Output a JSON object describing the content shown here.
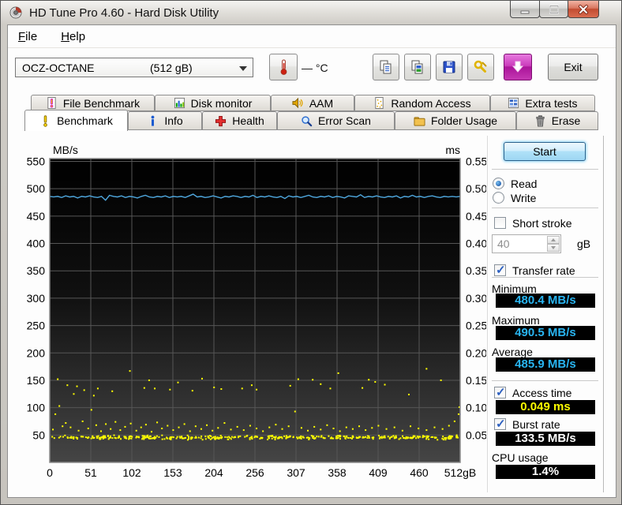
{
  "window": {
    "title": "HD Tune Pro 4.60 - Hard Disk Utility"
  },
  "menu": {
    "file": "File",
    "help": "Help"
  },
  "toolbar": {
    "drive": {
      "name": "OCZ-OCTANE",
      "capacity": "(512 gB)"
    },
    "temperature_display": "— °C",
    "buttons": {
      "copy_text": "copy-text",
      "copy_image": "copy-image",
      "save": "save",
      "options": "options",
      "download": "download",
      "temperature": "temperature"
    },
    "exit_label": "Exit"
  },
  "tabs": {
    "row1": [
      {
        "label": "File Benchmark",
        "icon": "file-benchmark-icon"
      },
      {
        "label": "Disk monitor",
        "icon": "disk-monitor-icon"
      },
      {
        "label": "AAM",
        "icon": "aam-icon"
      },
      {
        "label": "Random Access",
        "icon": "random-access-icon"
      },
      {
        "label": "Extra tests",
        "icon": "extra-tests-icon"
      }
    ],
    "row2": [
      {
        "label": "Benchmark",
        "icon": "benchmark-icon",
        "active": true
      },
      {
        "label": "Info",
        "icon": "info-icon"
      },
      {
        "label": "Health",
        "icon": "health-icon"
      },
      {
        "label": "Error Scan",
        "icon": "error-scan-icon"
      },
      {
        "label": "Folder Usage",
        "icon": "folder-usage-icon"
      },
      {
        "label": "Erase",
        "icon": "erase-icon"
      }
    ],
    "active": "Benchmark"
  },
  "chart_data": {
    "type": "line+scatter",
    "left_axis": {
      "label": "MB/s",
      "tick_values": [
        550,
        500,
        450,
        400,
        350,
        300,
        250,
        200,
        150,
        100,
        50
      ],
      "tick_labels": [
        "550",
        "500",
        "450",
        "400",
        "350",
        "300",
        "250",
        "200",
        "150",
        "100",
        "50"
      ],
      "range": [
        0,
        555
      ]
    },
    "right_axis": {
      "label": "ms",
      "tick_labels": [
        "0.55",
        "0.50",
        "0.45",
        "0.40",
        "0.35",
        "0.30",
        "0.25",
        "0.20",
        "0.15",
        "0.10",
        "0.05"
      ],
      "range": [
        0,
        0.555
      ]
    },
    "x_axis": {
      "tick_labels": [
        "0",
        "51",
        "102",
        "153",
        "204",
        "256",
        "307",
        "358",
        "409",
        "460",
        "512gB"
      ],
      "range": [
        0,
        512
      ]
    },
    "grid_color": "#565656",
    "plot_border_color": "#8a8a8a",
    "series": [
      {
        "name": "Transfer rate",
        "type": "line",
        "color": "#4fa8df",
        "unit": "MB/s",
        "x_range": [
          0,
          512
        ],
        "values": [
          486,
          485,
          486,
          484,
          487,
          485,
          486,
          483,
          486,
          485,
          487,
          485,
          484,
          486,
          479,
          488,
          486,
          485,
          487,
          484,
          486,
          485,
          483,
          486,
          488,
          485,
          484,
          486,
          485,
          487,
          484,
          486,
          485,
          486,
          484,
          487,
          490,
          485,
          486,
          484,
          485,
          487,
          485,
          483,
          486,
          485,
          487,
          486,
          484,
          486,
          485,
          488,
          484,
          486,
          485,
          487,
          485,
          484,
          486,
          482,
          487,
          485,
          486,
          484,
          486,
          488,
          485,
          484,
          486,
          485,
          487,
          484,
          486,
          485,
          483,
          487,
          486,
          485,
          489,
          484,
          486,
          485,
          487,
          485,
          484,
          486,
          485,
          487,
          483,
          486,
          485,
          488,
          485,
          486,
          484,
          486,
          487,
          485,
          484,
          486,
          485,
          486,
          485,
          486
        ]
      },
      {
        "name": "Access time",
        "type": "scatter",
        "color": "#ffff00",
        "unit": "ms",
        "points": [
          [
            10,
            0.152
          ],
          [
            22,
            0.141
          ],
          [
            30,
            0.125
          ],
          [
            34,
            0.139
          ],
          [
            43,
            0.132
          ],
          [
            55,
            0.122
          ],
          [
            60,
            0.135
          ],
          [
            78,
            0.13
          ],
          [
            100,
            0.167
          ],
          [
            118,
            0.136
          ],
          [
            124,
            0.15
          ],
          [
            131,
            0.135
          ],
          [
            150,
            0.133
          ],
          [
            160,
            0.146
          ],
          [
            178,
            0.131
          ],
          [
            190,
            0.153
          ],
          [
            205,
            0.137
          ],
          [
            214,
            0.134
          ],
          [
            240,
            0.135
          ],
          [
            252,
            0.141
          ],
          [
            258,
            0.133
          ],
          [
            300,
            0.14
          ],
          [
            310,
            0.152
          ],
          [
            328,
            0.151
          ],
          [
            338,
            0.143
          ],
          [
            350,
            0.135
          ],
          [
            360,
            0.163
          ],
          [
            390,
            0.136
          ],
          [
            398,
            0.151
          ],
          [
            406,
            0.147
          ],
          [
            418,
            0.142
          ],
          [
            448,
            0.124
          ],
          [
            470,
            0.171
          ],
          [
            488,
            0.15
          ],
          [
            4,
            0.06
          ],
          [
            7,
            0.088
          ],
          [
            12,
            0.103
          ],
          [
            16,
            0.066
          ],
          [
            20,
            0.072
          ],
          [
            26,
            0.064
          ],
          [
            36,
            0.058
          ],
          [
            41,
            0.075
          ],
          [
            48,
            0.062
          ],
          [
            52,
            0.096
          ],
          [
            58,
            0.068
          ],
          [
            64,
            0.057
          ],
          [
            70,
            0.07
          ],
          [
            76,
            0.061
          ],
          [
            82,
            0.074
          ],
          [
            88,
            0.059
          ],
          [
            94,
            0.065
          ],
          [
            101,
            0.071
          ],
          [
            108,
            0.058
          ],
          [
            114,
            0.064
          ],
          [
            120,
            0.069
          ],
          [
            127,
            0.056
          ],
          [
            134,
            0.073
          ],
          [
            140,
            0.062
          ],
          [
            147,
            0.067
          ],
          [
            154,
            0.059
          ],
          [
            161,
            0.064
          ],
          [
            168,
            0.07
          ],
          [
            175,
            0.057
          ],
          [
            182,
            0.066
          ],
          [
            189,
            0.061
          ],
          [
            196,
            0.068
          ],
          [
            203,
            0.058
          ],
          [
            210,
            0.063
          ],
          [
            218,
            0.072
          ],
          [
            226,
            0.06
          ],
          [
            234,
            0.065
          ],
          [
            242,
            0.059
          ],
          [
            250,
            0.067
          ],
          [
            258,
            0.062
          ],
          [
            266,
            0.057
          ],
          [
            274,
            0.064
          ],
          [
            282,
            0.069
          ],
          [
            290,
            0.061
          ],
          [
            298,
            0.066
          ],
          [
            306,
            0.093
          ],
          [
            314,
            0.063
          ],
          [
            322,
            0.058
          ],
          [
            330,
            0.065
          ],
          [
            338,
            0.06
          ],
          [
            346,
            0.068
          ],
          [
            354,
            0.062
          ],
          [
            362,
            0.057
          ],
          [
            370,
            0.064
          ],
          [
            378,
            0.061
          ],
          [
            386,
            0.066
          ],
          [
            394,
            0.059
          ],
          [
            402,
            0.063
          ],
          [
            410,
            0.067
          ],
          [
            420,
            0.061
          ],
          [
            430,
            0.064
          ],
          [
            440,
            0.058
          ],
          [
            450,
            0.066
          ],
          [
            460,
            0.062
          ],
          [
            470,
            0.059
          ],
          [
            480,
            0.064
          ],
          [
            490,
            0.061
          ],
          [
            498,
            0.067
          ],
          [
            505,
            0.075
          ],
          [
            510,
            0.088
          ],
          [
            511,
            0.101
          ]
        ],
        "noise_band": {
          "count": 430,
          "ms_min": 0.041,
          "ms_max": 0.05,
          "x_min": 2,
          "x_max": 511,
          "seed": 42
        }
      }
    ]
  },
  "panel": {
    "start_label": "Start",
    "read_label": "Read",
    "write_label": "Write",
    "mode_selected": "Read",
    "read_checked": true,
    "write_checked": false,
    "short_stroke": {
      "label": "Short stroke",
      "checked": false,
      "value": "40",
      "unit": "gB"
    },
    "transfer_rate": {
      "label": "Transfer rate",
      "checked": true
    },
    "minimum": {
      "label": "Minimum",
      "value": "480.4 MB/s"
    },
    "maximum": {
      "label": "Maximum",
      "value": "490.5 MB/s"
    },
    "average": {
      "label": "Average",
      "value": "485.9 MB/s"
    },
    "access_time": {
      "label": "Access time",
      "checked": true,
      "value": "0.049 ms"
    },
    "burst_rate": {
      "label": "Burst rate",
      "checked": true,
      "value": "133.5 MB/s"
    },
    "cpu_usage": {
      "label": "CPU usage",
      "value": "1.4%"
    },
    "value_colors": {
      "rate": "#29b5f2",
      "access_time": "#ffff00",
      "plain": "#ffffff"
    }
  }
}
